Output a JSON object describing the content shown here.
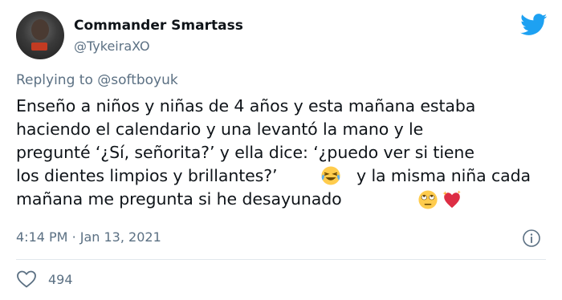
{
  "author": {
    "display_name": "Commander Smartass",
    "handle": "@TykeiraXO"
  },
  "reply": {
    "prefix": "Replying to",
    "mention": "@softboyuk"
  },
  "tweet": {
    "lines": [
      "Enseño a niños y niñas de 4 años y esta mañana estaba",
      "haciendo el calendario y una levantó la mano y le",
      "pregunté ‘¿Sí, señorita?’ y ella dice: ‘¿puedo ver si tiene",
      "los dientes limpios y brillantes?’",
      "y la misma niña cada",
      "mañana me pregunta si he desayunado"
    ],
    "emojis": [
      "face-with-tears-of-joy",
      "face-with-rolling-eyes",
      "sparkling-heart"
    ]
  },
  "meta": {
    "time": "4:14 PM",
    "separator": "·",
    "date": "Jan 13, 2021"
  },
  "engagement": {
    "likes": "494"
  },
  "colors": {
    "brand": "#1da1f2",
    "secondary_text": "#5b7083",
    "primary_text": "#0f1419",
    "divider": "#e1e8ed"
  },
  "icons": [
    "avatar",
    "twitter-bird-icon",
    "info-icon",
    "heart-outline-icon"
  ]
}
